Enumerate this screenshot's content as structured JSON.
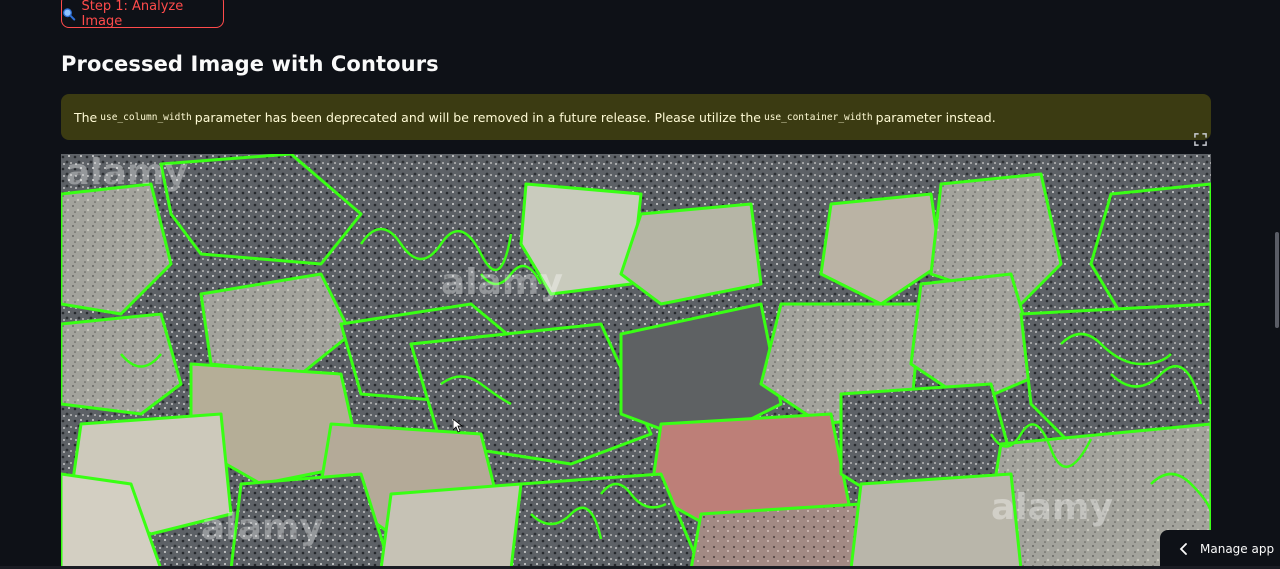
{
  "step_button": {
    "icon": "magnifier-icon",
    "label": "Step 1: Analyze Image"
  },
  "heading": "Processed Image with Contours",
  "warning": {
    "prefix": "The",
    "code1": "use_column_width",
    "middle": "parameter has been deprecated and will be removed in a future release. Please utilize the",
    "code2": "use_container_width",
    "suffix": "parameter instead."
  },
  "image": {
    "description_icon": "rocks-with-green-contours",
    "watermark": "alamy",
    "contour_color": "#39ff14"
  },
  "manage_app": {
    "icon": "chevron-left-icon",
    "label": "Manage app"
  },
  "colors": {
    "background": "#0e1117",
    "accent": "#ff4b4b",
    "warning_bg": "#3b3b12",
    "warning_text": "#fffbd6"
  }
}
